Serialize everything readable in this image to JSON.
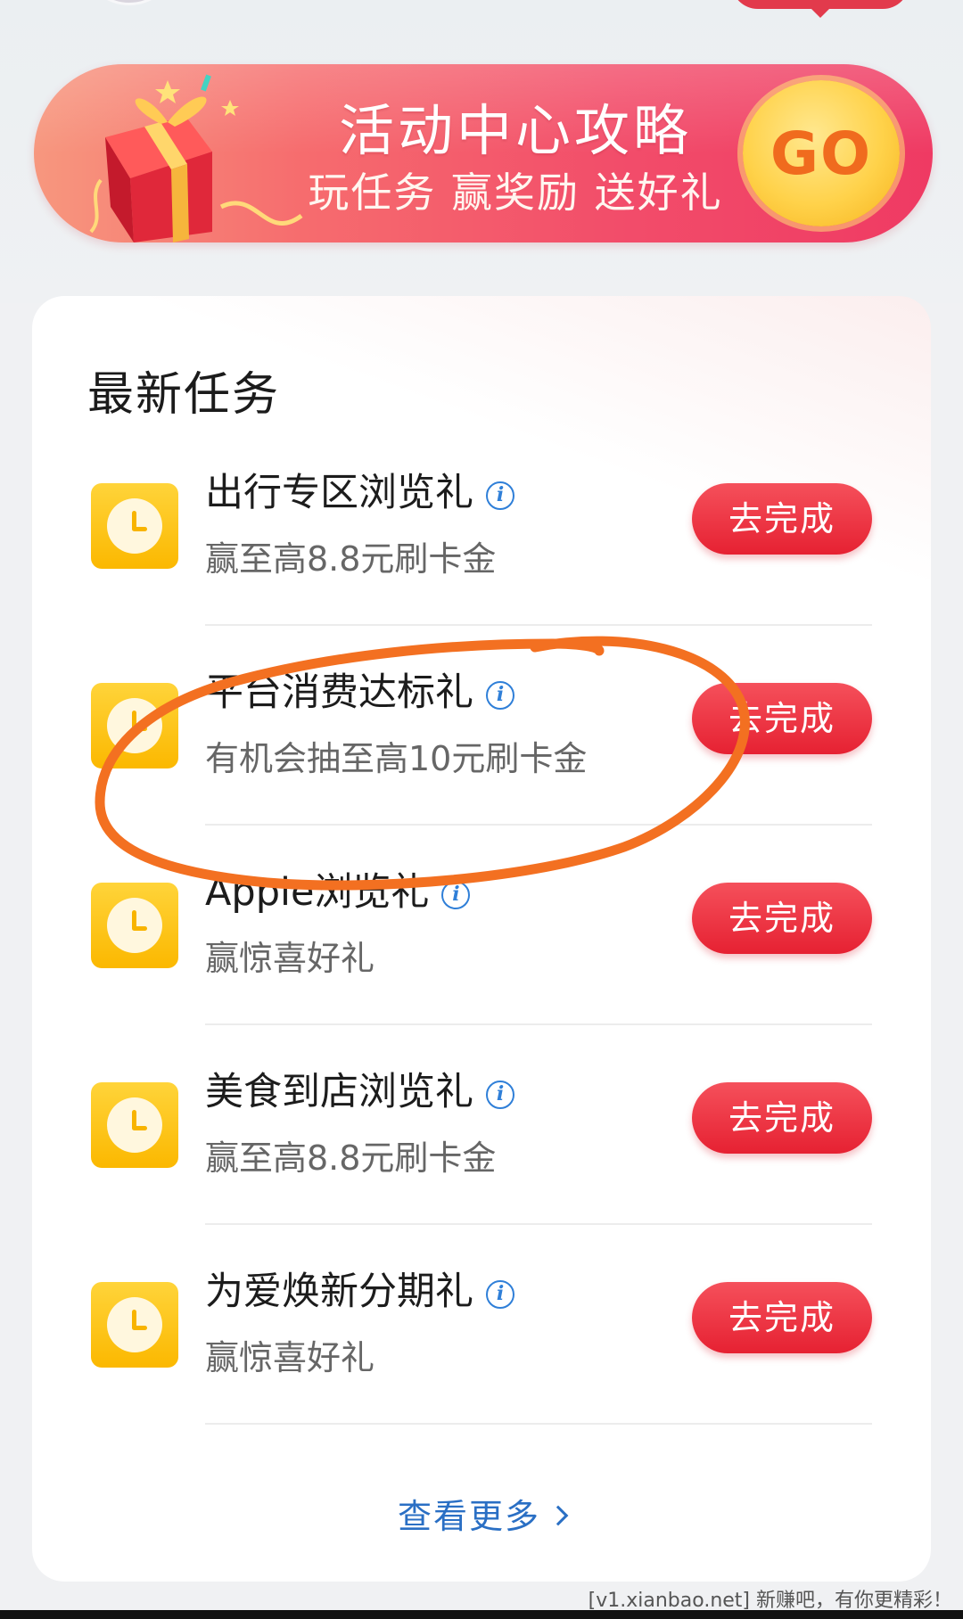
{
  "banner": {
    "title": "活动中心攻略",
    "subtitle": "玩任务 赢奖励 送好礼",
    "go_label": "GO"
  },
  "section": {
    "title": "最新任务"
  },
  "tasks": [
    {
      "name": "出行专区浏览礼",
      "desc": "赢至高8.8元刷卡金",
      "button": "去完成"
    },
    {
      "name": "平台消费达标礼",
      "desc": "有机会抽至高10元刷卡金",
      "button": "去完成"
    },
    {
      "name": "Apple浏览礼",
      "desc": "赢惊喜好礼",
      "button": "去完成"
    },
    {
      "name": "美食到店浏览礼",
      "desc": "赢至高8.8元刷卡金",
      "button": "去完成"
    },
    {
      "name": "为爱焕新分期礼",
      "desc": "赢惊喜好礼",
      "button": "去完成"
    }
  ],
  "more_label": "查看更多",
  "info_glyph": "i",
  "watermark": "[v1.xianbao.net] 新赚吧，有你更精彩！",
  "colors": {
    "primary_red": "#e62132",
    "link_blue": "#2a6fc4",
    "icon_yellow": "#fbb800",
    "annotation_orange": "#f37021"
  }
}
